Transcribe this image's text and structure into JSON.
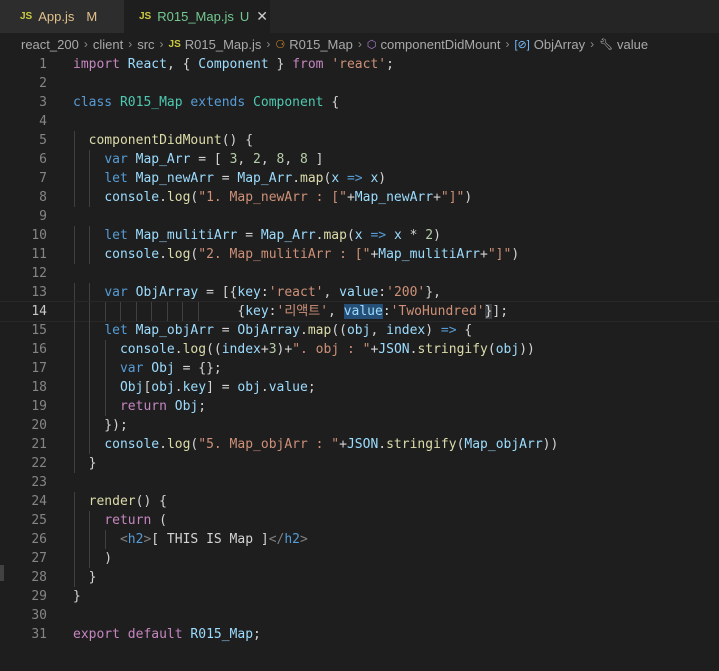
{
  "tabs": [
    {
      "icon": "JS",
      "name": "App.js",
      "badge": "M"
    },
    {
      "icon": "JS",
      "name": "R015_Map.js",
      "badge": "U",
      "close": "✕"
    }
  ],
  "breadcrumb": {
    "items": [
      "react_200",
      "client",
      "src",
      "R015_Map.js",
      "R015_Map",
      "componentDidMount",
      "ObjArray",
      "value"
    ]
  },
  "editor": {
    "current_line": 14,
    "lines": [
      {
        "n": "1",
        "html": "<span class=\"kc\">import</span> <span class=\"v\">React</span>, { <span class=\"v\">Component</span> } <span class=\"kc\">from</span> <span class=\"s\">'react'</span>;"
      },
      {
        "n": "2",
        "html": ""
      },
      {
        "n": "3",
        "html": "<span class=\"k\">class</span> <span class=\"t\">R015_Map</span> <span class=\"k\">extends</span> <span class=\"t\">Component</span> {"
      },
      {
        "n": "4",
        "html": ""
      },
      {
        "n": "5",
        "html": "  <span class=\"f\">componentDidMount</span>() {"
      },
      {
        "n": "6",
        "html": "    <span class=\"k\">var</span> <span class=\"v\">Map_Arr</span> = [ <span class=\"n\">3</span>, <span class=\"n\">2</span>, <span class=\"n\">8</span>, <span class=\"n\">8</span> ]"
      },
      {
        "n": "7",
        "html": "    <span class=\"k\">let</span> <span class=\"v\">Map_newArr</span> = <span class=\"v\">Map_Arr</span>.<span class=\"f\">map</span>(<span class=\"v\">x</span> <span class=\"k\">=></span> <span class=\"v\">x</span>)"
      },
      {
        "n": "8",
        "html": "    <span class=\"v\">console</span>.<span class=\"f\">log</span>(<span class=\"s\">\"1. Map_newArr : [\"</span>+<span class=\"v\">Map_newArr</span>+<span class=\"s\">\"]\"</span>)"
      },
      {
        "n": "9",
        "html": ""
      },
      {
        "n": "10",
        "html": "    <span class=\"k\">let</span> <span class=\"v\">Map_mulitiArr</span> = <span class=\"v\">Map_Arr</span>.<span class=\"f\">map</span>(<span class=\"v\">x</span> <span class=\"k\">=></span> <span class=\"v\">x</span> * <span class=\"n\">2</span>)"
      },
      {
        "n": "11",
        "html": "    <span class=\"v\">console</span>.<span class=\"f\">log</span>(<span class=\"s\">\"2. Map_mulitiArr : [\"</span>+<span class=\"v\">Map_mulitiArr</span>+<span class=\"s\">\"]\"</span>)"
      },
      {
        "n": "12",
        "html": ""
      },
      {
        "n": "13",
        "html": "    <span class=\"k\">var</span> <span class=\"v\">ObjArray</span> = [{<span class=\"v\">key</span>:<span class=\"s\">'react'</span>, <span class=\"v\">value</span>:<span class=\"s\">'200'</span>},"
      },
      {
        "n": "14",
        "html": "                     {<span class=\"v\">key</span>:<span class=\"s\">'리액트'</span>, <span class=\"v sel\">value</span>:<span class=\"s\">'TwoHundred'</span><span class=\"mark\">}</span>];"
      },
      {
        "n": "15",
        "html": "    <span class=\"k\">let</span> <span class=\"v\">Map_objArr</span> = <span class=\"v\">ObjArray</span>.<span class=\"f\">map</span>((<span class=\"v\">obj</span>, <span class=\"v\">index</span>) <span class=\"k\">=></span> {"
      },
      {
        "n": "16",
        "html": "      <span class=\"v\">console</span>.<span class=\"f\">log</span>((<span class=\"v\">index</span>+<span class=\"n\">3</span>)+<span class=\"s\">\". obj : \"</span>+<span class=\"v\">JSON</span>.<span class=\"f\">stringify</span>(<span class=\"v\">obj</span>))"
      },
      {
        "n": "17",
        "html": "      <span class=\"k\">var</span> <span class=\"v\">Obj</span> = {};"
      },
      {
        "n": "18",
        "html": "      <span class=\"v\">Obj</span>[<span class=\"v\">obj</span>.<span class=\"v\">key</span>] = <span class=\"v\">obj</span>.<span class=\"v\">value</span>;"
      },
      {
        "n": "19",
        "html": "      <span class=\"kc\">return</span> <span class=\"v\">Obj</span>;"
      },
      {
        "n": "20",
        "html": "    });"
      },
      {
        "n": "21",
        "html": "    <span class=\"v\">console</span>.<span class=\"f\">log</span>(<span class=\"s\">\"5. Map_objArr : \"</span>+<span class=\"v\">JSON</span>.<span class=\"f\">stringify</span>(<span class=\"v\">Map_objArr</span>))"
      },
      {
        "n": "22",
        "html": "  }"
      },
      {
        "n": "23",
        "html": ""
      },
      {
        "n": "24",
        "html": "  <span class=\"f\">render</span>() {"
      },
      {
        "n": "25",
        "html": "    <span class=\"kc\">return</span> ("
      },
      {
        "n": "26",
        "html": "      <span class=\"tg\">&lt;</span><span class=\"tn\">h2</span><span class=\"tg\">&gt;</span>[ THIS IS Map ]<span class=\"tg\">&lt;/</span><span class=\"tn\">h2</span><span class=\"tg\">&gt;</span>"
      },
      {
        "n": "27",
        "html": "    )"
      },
      {
        "n": "28",
        "html": "  }"
      },
      {
        "n": "29",
        "html": "}"
      },
      {
        "n": "30",
        "html": ""
      },
      {
        "n": "31",
        "html": "<span class=\"kc\">export</span> <span class=\"kc\">default</span> <span class=\"v\">R015_Map</span>;"
      }
    ]
  }
}
